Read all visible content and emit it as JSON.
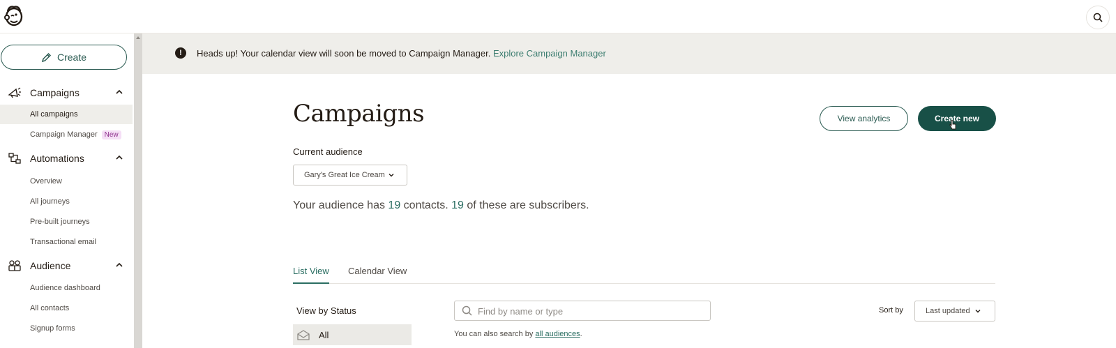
{
  "topbar": {
    "logo_icon": "mailchimp-freddie-logo",
    "search_icon": "search-icon"
  },
  "sidebar": {
    "create_label": "Create",
    "sections": [
      {
        "label": "Campaigns",
        "icon": "megaphone-icon",
        "items": [
          {
            "label": "All campaigns",
            "active": true
          },
          {
            "label": "Campaign Manager",
            "badge": "New"
          }
        ]
      },
      {
        "label": "Automations",
        "icon": "automation-flow-icon",
        "items": [
          {
            "label": "Overview"
          },
          {
            "label": "All journeys"
          },
          {
            "label": "Pre-built journeys"
          },
          {
            "label": "Transactional email"
          }
        ]
      },
      {
        "label": "Audience",
        "icon": "audience-icon",
        "items": [
          {
            "label": "Audience dashboard"
          },
          {
            "label": "All contacts"
          },
          {
            "label": "Signup forms"
          }
        ]
      }
    ]
  },
  "banner": {
    "text": "Heads up! Your calendar view will soon be moved to Campaign Manager.",
    "link": "Explore Campaign Manager"
  },
  "main": {
    "title": "Campaigns",
    "view_analytics": "View analytics",
    "create_new": "Create new",
    "current_audience_label": "Current audience",
    "audience_selected": "Gary's Great Ice Cream",
    "summary": {
      "prefix": "Your audience has",
      "contacts": "19",
      "middle": "contacts.",
      "subscribers": "19",
      "suffix": "of these are subscribers."
    },
    "tabs": [
      {
        "label": "List View",
        "active": true
      },
      {
        "label": "Calendar View",
        "active": false
      }
    ],
    "view_by_status_label": "View by Status",
    "status_all": "All",
    "search_placeholder": "Find by name or type",
    "search_hint_prefix": "You can also search by",
    "search_hint_link": "all audiences",
    "search_hint_suffix": ".",
    "sort_label": "Sort by",
    "sort_value": "Last updated"
  },
  "colors": {
    "accent": "#185047",
    "link": "#2b6e62",
    "banner_bg": "#efeeea",
    "active_item_bg": "#efeeea",
    "badge_bg": "#f5dff6"
  }
}
